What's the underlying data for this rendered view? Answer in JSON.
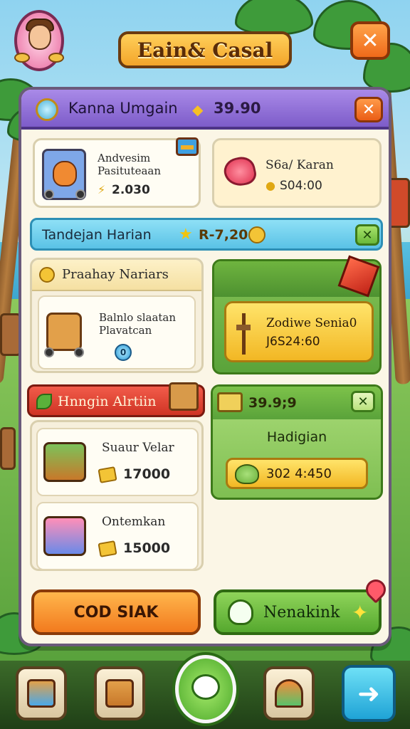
{
  "header": {
    "title": "Eain& Casal",
    "close_symbol": "✕"
  },
  "profile": {
    "name": "Kanna Umgain",
    "balance": "39.90"
  },
  "featured": {
    "left": {
      "line1": "Andvesim",
      "line2": "Pasituteaan",
      "price": "2.030"
    },
    "right": {
      "title": "S6a/ Karan",
      "price": "S04:00"
    }
  },
  "daily": {
    "label": "Tandejan Harian",
    "value": "R-7,20"
  },
  "prizes": {
    "title": "Praahay Nariars",
    "line1": "Balnlo slaatan",
    "line2": "Plavatcan",
    "counter": "0"
  },
  "special": {
    "label": "Zodiwe Senia0",
    "value": "J6S24:60"
  },
  "shop": {
    "title": "Hnngin Alrtiin",
    "items": [
      {
        "name": "Suaur Velar",
        "price": "17000"
      },
      {
        "name": "Ontemkan",
        "price": "15000"
      }
    ]
  },
  "reward": {
    "ticket_value": "39.9;9",
    "label": "Hadigian",
    "value": "302 4:450"
  },
  "actions": {
    "left_label": "COD SIAK",
    "right_label": "Nenakink"
  },
  "nav": {
    "next_symbol": "➜"
  },
  "colors": {
    "header_purple": "#7d5cc9",
    "daily_blue": "#5ac2e6",
    "shop_red": "#cf3424",
    "cta_orange": "#f27a1e",
    "cta_green": "#55a82e",
    "gold": "#f2b724"
  }
}
